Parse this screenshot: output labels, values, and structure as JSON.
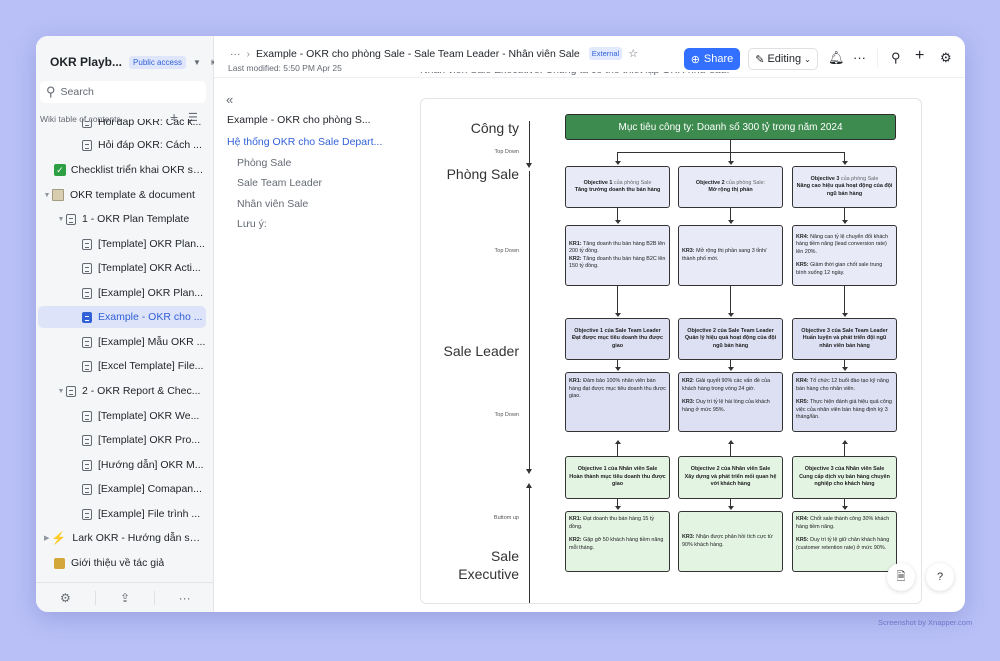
{
  "sidebar": {
    "title": "OKR Playb...",
    "access_badge": "Public access",
    "search_placeholder": "Search",
    "toc_label": "Wiki table of contents",
    "items": [
      {
        "label": "Hỏi đáp OKR: Các k...",
        "type": "doc"
      },
      {
        "label": "Hỏi đáp OKR: Cách ...",
        "type": "doc"
      },
      {
        "label": "Checklist triển khai OKR sa...",
        "type": "check"
      },
      {
        "label": "OKR template & document",
        "type": "folder"
      },
      {
        "label": "1 - OKR Plan Template",
        "type": "doc"
      },
      {
        "label": "[Template] OKR Plan...",
        "type": "doc"
      },
      {
        "label": "[Template] OKR Acti...",
        "type": "sheet"
      },
      {
        "label": "[Example] OKR Plan...",
        "type": "doc"
      },
      {
        "label": "Example - OKR cho ...",
        "type": "doc",
        "active": true
      },
      {
        "label": "[Example] Mẫu OKR ...",
        "type": "doc"
      },
      {
        "label": "[Excel Template] File...",
        "type": "doc"
      },
      {
        "label": "2 - OKR Report & Chec...",
        "type": "doc"
      },
      {
        "label": "[Template] OKR We...",
        "type": "doc"
      },
      {
        "label": "[Template] OKR Pro...",
        "type": "doc"
      },
      {
        "label": "[Hướng dẫn] OKR M...",
        "type": "doc"
      },
      {
        "label": "[Example] Comapan...",
        "type": "doc"
      },
      {
        "label": "[Example] File trình ...",
        "type": "doc"
      },
      {
        "label": "Lark OKR - Hướng dẫn sử d...",
        "type": "bolt"
      },
      {
        "label": "Giới thiệu về tác giả",
        "type": "person"
      }
    ],
    "footer_icons": [
      "settings-icon",
      "share-icon",
      "more-icon"
    ]
  },
  "header": {
    "breadcrumb_more": "···",
    "breadcrumb_title": "Example - OKR cho phòng Sale  - Sale Team Leader - Nhân viên Sale",
    "external_badge": "External",
    "last_modified": "Last modified: 5:50 PM Apr 25",
    "share_label": "Share",
    "editing_label": "Editing",
    "more": "···"
  },
  "outline": {
    "items": [
      {
        "label": "Example - OKR cho phòng S...",
        "level": 1
      },
      {
        "label": "Hệ thống OKR cho Sale Depart...",
        "level": 1,
        "active": true
      },
      {
        "label": "Phòng Sale",
        "level": 2
      },
      {
        "label": "Sale Team Leader",
        "level": 2
      },
      {
        "label": "Nhân viên Sale",
        "level": 2
      },
      {
        "label": "Lưu ý:",
        "level": 2
      }
    ]
  },
  "document": {
    "intro_text": "Nhân viên Sale Executive. Chúng ta có thể thiết lập OKR như sau:",
    "diagram": {
      "levels": {
        "company": "Công ty",
        "sale_dept": "Phòng Sale",
        "sale_leader": "Sale Leader",
        "sale_exec_1": "Sale",
        "sale_exec_2": "Executive"
      },
      "directions": {
        "d1": "Top Down",
        "d2": "Top Down",
        "d3": "Top Down",
        "d4": "Buttom up"
      },
      "company_goal": "Mục tiêu công ty: Doanh số 300 tỷ trong năm 2024",
      "dept_objectives": [
        {
          "title": "Objective 1",
          "suffix": " của phòng Sale",
          "desc": "Tăng trưởng doanh thu bán hàng"
        },
        {
          "title": "Objective 2",
          "suffix": " của phòng Sale:",
          "desc": "Mở rộng thị phần"
        },
        {
          "title": "Objective 3",
          "suffix": " của phòng Sale",
          "desc": "Nâng cao hiệu quả hoạt động của đội ngũ bán hàng"
        }
      ],
      "dept_krs": [
        [
          {
            "k": "KR1:",
            "t": " Tăng doanh thu bán hàng B2B lên 200 tỷ đồng."
          },
          {
            "k": "KR2:",
            "t": " Tăng doanh thu bán hàng B2C lên 150  tỷ đồng."
          }
        ],
        [
          {
            "k": "KR3:",
            "t": " Mở rộng thị phần sang 3 tỉnh/ thành phố mới."
          }
        ],
        [
          {
            "k": "KR4:",
            "t": " Nâng cao tỷ lệ chuyển đổi khách hàng tiềm năng (lead conversion rate) lên 20%."
          },
          {
            "k": "KR5:",
            "t": " Giảm thời gian chốt sale trung bình xuống 12 ngày."
          }
        ]
      ],
      "leader_objectives": [
        {
          "title": "Objective 1 của Sale Team Leader",
          "desc": "Đạt được mục tiêu doanh thu được giao"
        },
        {
          "title": "Objective 2 của Sale Team Leader",
          "desc": "Quản lý hiệu quả hoạt động của đội ngũ bán hàng"
        },
        {
          "title": "Objective 3 của Sale Team Leader",
          "desc": "Huấn luyện và phát triển đội ngũ nhân viên bán hàng"
        }
      ],
      "leader_krs": [
        [
          {
            "k": "KR1:",
            "t": " Đảm bảo 100% nhân viên bán hàng đạt được mục tiêu doanh thu được giao."
          }
        ],
        [
          {
            "k": "KR2",
            "t": ": Giải quyết 90% các vấn đề của khách hàng trong vòng 24 giờ."
          },
          {
            "k": "KR3:",
            "t": " Duy trì tỷ lệ hài lòng của khách hàng ở mức 95%."
          }
        ],
        [
          {
            "k": "KR4:",
            "t": " Tổ chức 12 buổi đào tạo kỹ năng bán hàng cho nhân viên."
          },
          {
            "k": "KR5:",
            "t": " Thực hiện đánh giá hiệu quả công việc của nhân viên bán hàng định kỳ 3 tháng/lần."
          }
        ]
      ],
      "exec_objectives": [
        {
          "title": "Objective 1 của Nhân viên Sale",
          "desc": "Hoàn thành mục tiêu doanh thu được giao"
        },
        {
          "title": "Objective 2 của Nhân viên Sale",
          "desc": "Xây dựng và phát triển mối quan hệ với khách hàng"
        },
        {
          "title": "Objective 3 của Nhân viên Sale",
          "desc": "Cung cấp dịch vụ bán hàng chuyên nghiệp cho khách hàng"
        }
      ],
      "exec_krs": [
        [
          {
            "k": "KR1:",
            "t": " Đạt doanh thu bán hàng 15 tỷ đồng."
          },
          {
            "k": "KR2:",
            "t": " Gặp gỡ 50 khách hàng tiềm năng mỗi tháng."
          }
        ],
        [
          {
            "k": "KR3:",
            "t": " Nhận được phản hồi tích cực từ 90% khách hàng."
          }
        ],
        [
          {
            "k": "KR4:",
            "t": " Chốt sale thành công 30% khách hàng tiềm năng."
          },
          {
            "k": "KR5:",
            "t": " Duy trì tỷ lệ giữ chân khách hàng (customer retention rate) ở mức 90%."
          }
        ]
      ]
    }
  },
  "watermark": "Screenshot by Xnapper.com",
  "colors": {
    "accent": "#3370ff",
    "company_box": "#3d8b4e",
    "dept_box": "#e8eaf8",
    "leader_box": "#dde0f3",
    "exec_box": "#e3f4e3",
    "background": "#b9c0f7"
  }
}
